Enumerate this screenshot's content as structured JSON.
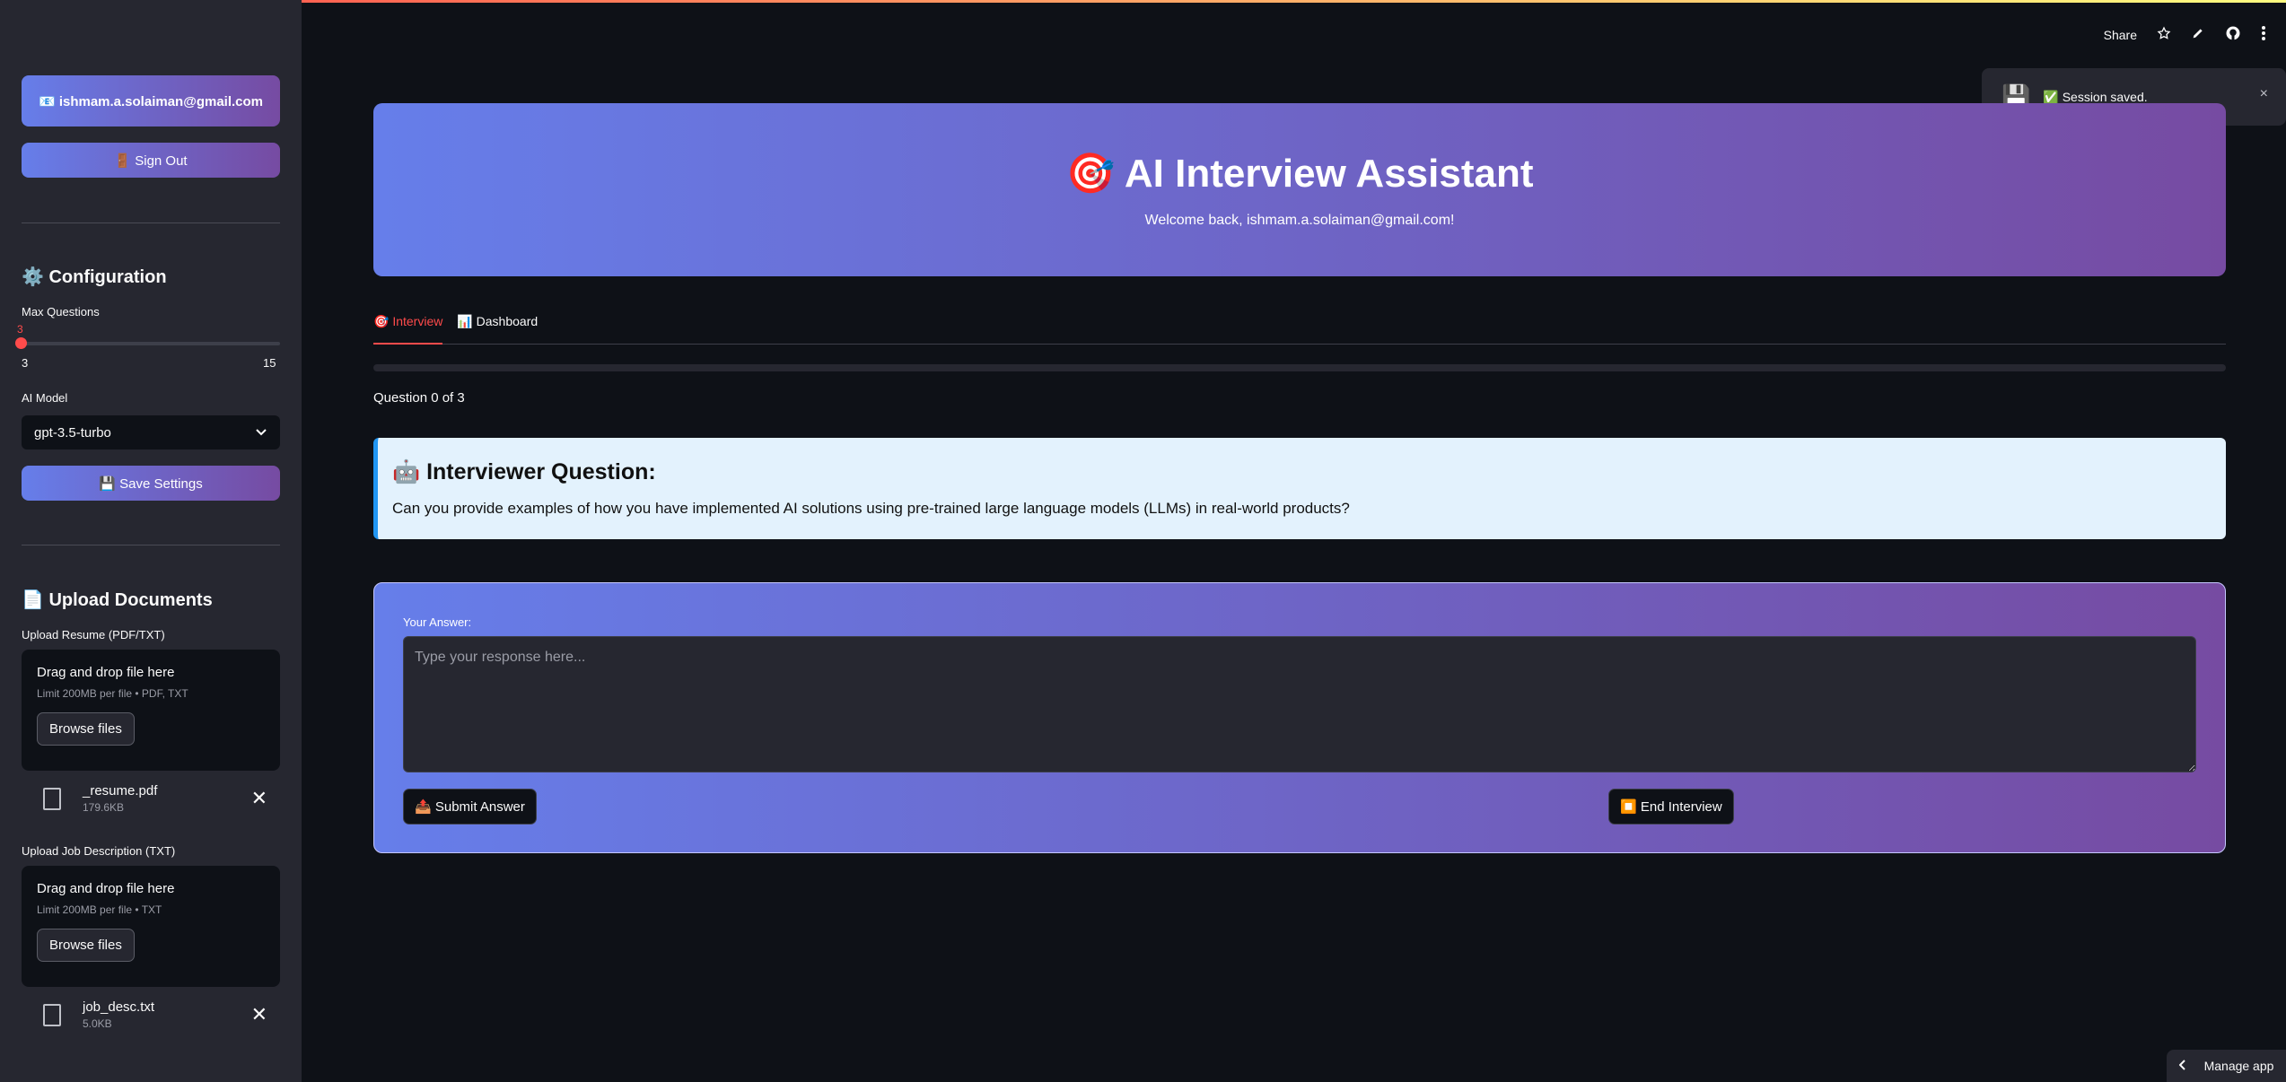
{
  "sidebar": {
    "user_button": "📧 ishmam.a.solaiman@gmail.com",
    "sign_out": "🚪 Sign Out",
    "config_title": "⚙️ Configuration",
    "max_questions_label": "Max Questions",
    "slider": {
      "value": "3",
      "min": "3",
      "max": "15"
    },
    "ai_model_label": "AI Model",
    "ai_model_value": "gpt-3.5-turbo",
    "save_settings": "💾 Save Settings",
    "upload_title": "📄 Upload Documents",
    "resume_label": "Upload Resume (PDF/TXT)",
    "resume_dropzone": {
      "title": "Drag and drop file here",
      "limit": "Limit 200MB per file • PDF, TXT",
      "browse": "Browse files"
    },
    "resume_file": {
      "name": "_resume.pdf",
      "size": "179.6KB"
    },
    "jd_label": "Upload Job Description (TXT)",
    "jd_dropzone": {
      "title": "Drag and drop file here",
      "limit": "Limit 200MB per file • TXT",
      "browse": "Browse files"
    },
    "jd_file": {
      "name": "job_desc.txt",
      "size": "5.0KB"
    }
  },
  "toolbar": {
    "share": "Share",
    "star_icon": "star-icon",
    "edit_icon": "pencil-icon",
    "github_icon": "github-icon",
    "menu_icon": "kebab-menu-icon"
  },
  "toast": {
    "icon": "💾",
    "message": "✅ Session saved.",
    "close": "×"
  },
  "header": {
    "title": "🎯 AI Interview Assistant",
    "welcome": "Welcome back, ishmam.a.solaiman@gmail.com!"
  },
  "tabs": [
    {
      "label": "🎯 Interview",
      "active": true
    },
    {
      "label": "📊 Dashboard",
      "active": false
    }
  ],
  "progress": {
    "fraction": 0,
    "text": "Question 0 of 3"
  },
  "question": {
    "title": "🤖 Interviewer Question:",
    "text": "Can you provide examples of how you have implemented AI solutions using pre-trained large language models (LLMs) in real-world products?"
  },
  "answer": {
    "label": "Your Answer:",
    "placeholder": "Type your response here...",
    "submit": "📤 Submit Answer",
    "end": "⏹️ End Interview"
  },
  "manage_app": "Manage app",
  "colors": {
    "accent": "#ff4b4b",
    "gradient_start": "#667eea",
    "gradient_end": "#764ba2",
    "question_bg": "#e3f2fd"
  }
}
